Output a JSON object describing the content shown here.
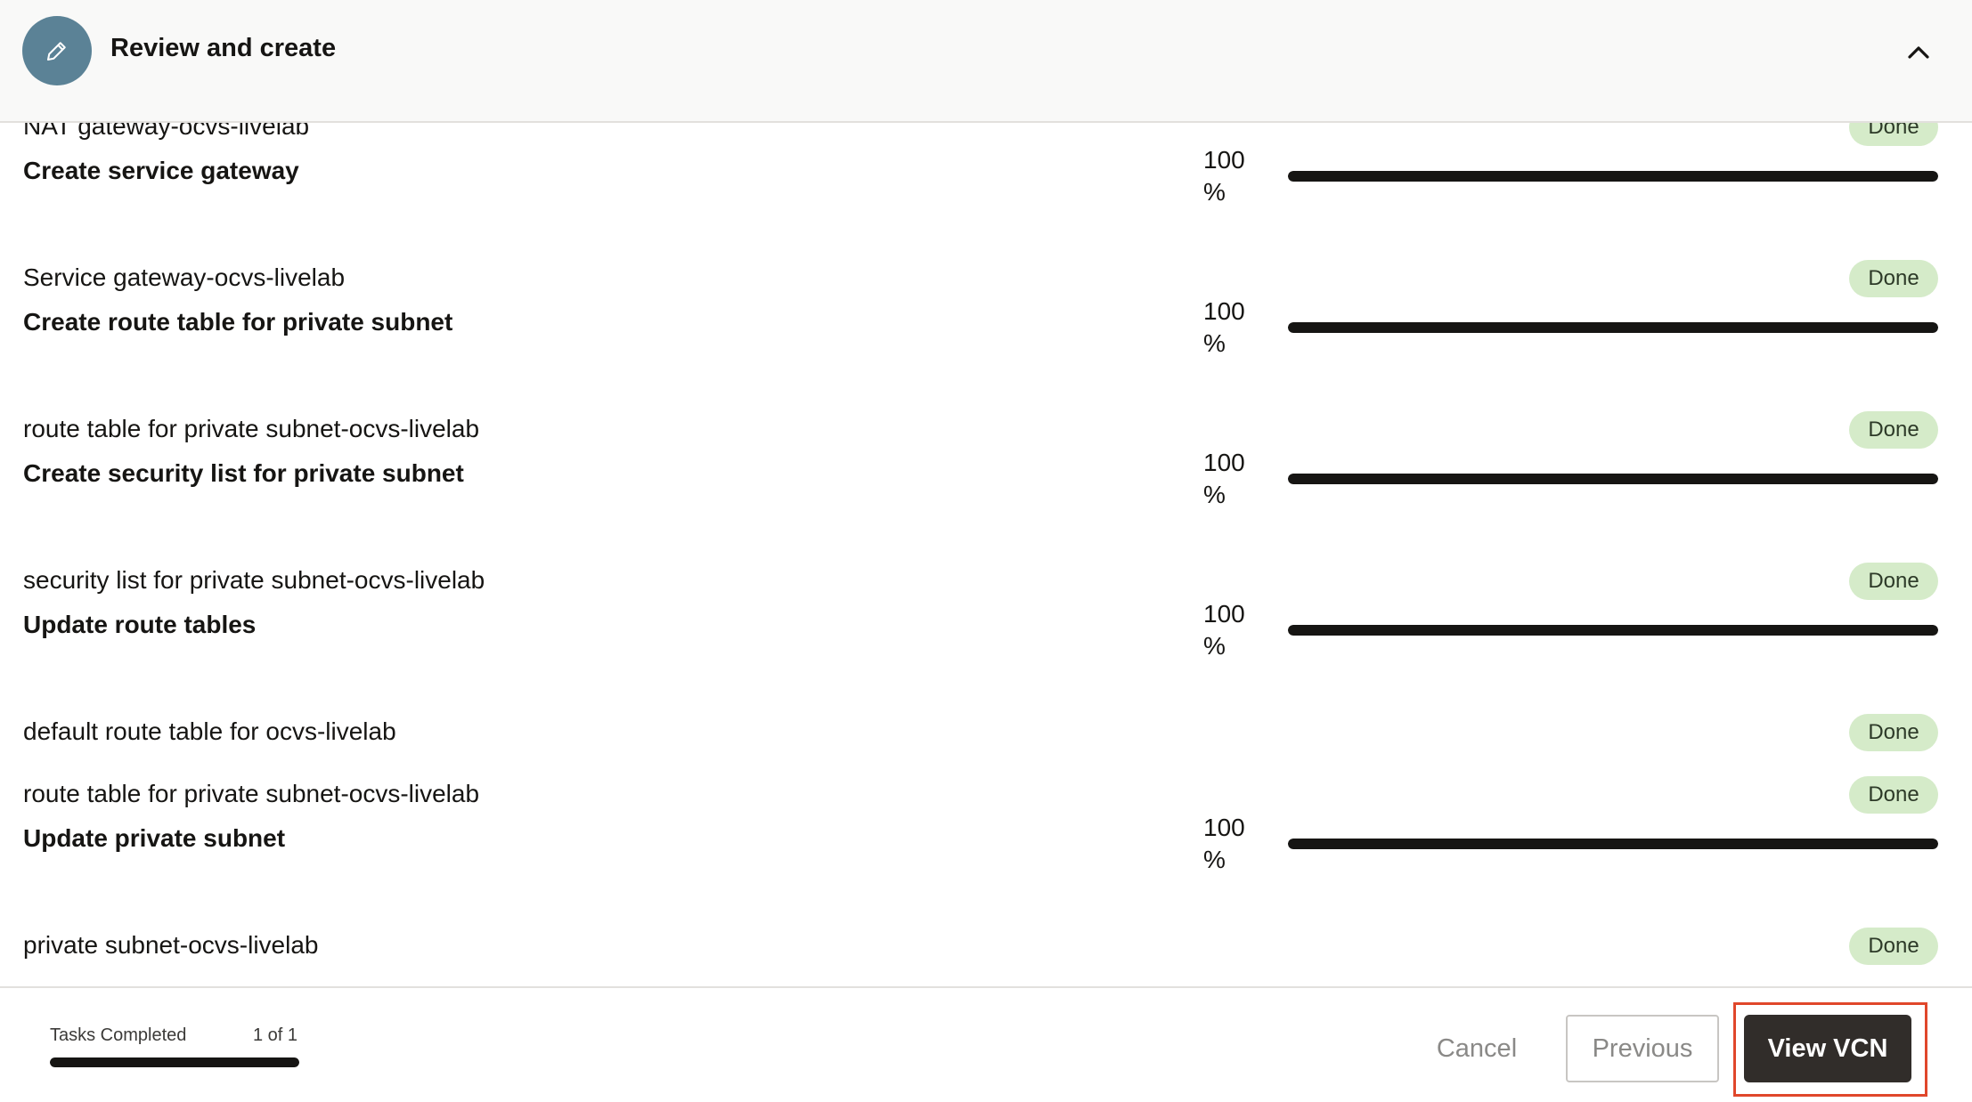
{
  "header": {
    "title": "Review and create",
    "step_icon": "pencil-icon",
    "collapse_icon": "chevron-up-icon"
  },
  "partial_resource": {
    "name": "NAT gateway-ocvs-livelab",
    "status": "Done"
  },
  "tasks": [
    {
      "name": "Create service gateway",
      "percent": "100",
      "percent_unit": "%",
      "progress": 100,
      "resources": [
        {
          "name": "Service gateway-ocvs-livelab",
          "status": "Done"
        }
      ]
    },
    {
      "name": "Create route table for private subnet",
      "percent": "100",
      "percent_unit": "%",
      "progress": 100,
      "resources": [
        {
          "name": "route table for private subnet-ocvs-livelab",
          "status": "Done"
        }
      ]
    },
    {
      "name": "Create security list for private subnet",
      "percent": "100",
      "percent_unit": "%",
      "progress": 100,
      "resources": [
        {
          "name": "security list for private subnet-ocvs-livelab",
          "status": "Done"
        }
      ]
    },
    {
      "name": "Update route tables",
      "percent": "100",
      "percent_unit": "%",
      "progress": 100,
      "resources": [
        {
          "name": "default route table for ocvs-livelab",
          "status": "Done"
        },
        {
          "name": "route table for private subnet-ocvs-livelab",
          "status": "Done"
        }
      ]
    },
    {
      "name": "Update private subnet",
      "percent": "100",
      "percent_unit": "%",
      "progress": 100,
      "resources": [
        {
          "name": "private subnet-ocvs-livelab",
          "status": "Done"
        }
      ]
    }
  ],
  "footer": {
    "tasks_completed_label": "Tasks Completed",
    "tasks_completed_count": "1 of 1",
    "tasks_completed_progress": 100,
    "cancel_label": "Cancel",
    "previous_label": "Previous",
    "view_vcn_label": "View VCN"
  },
  "colors": {
    "accent_circle": "#5b8296",
    "done_badge_bg": "#d5ebc9",
    "primary_button": "#312d2a",
    "highlight_box": "#e0472b"
  }
}
